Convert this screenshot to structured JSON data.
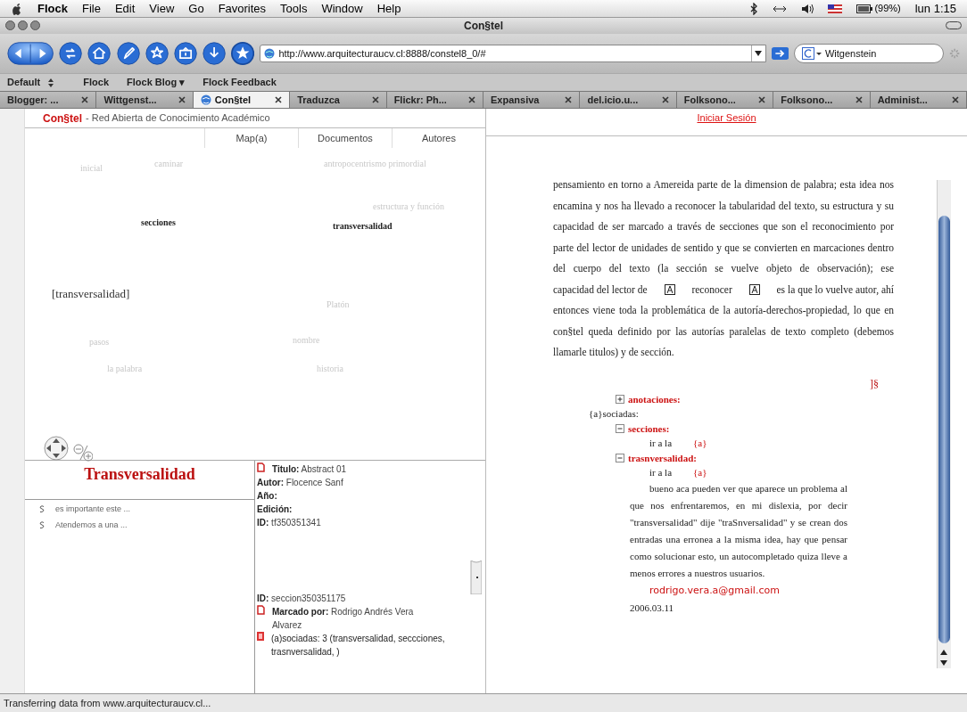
{
  "menu_bar": {
    "app": "Flock",
    "items": [
      "File",
      "Edit",
      "View",
      "Go",
      "Favorites",
      "Tools",
      "Window",
      "Help"
    ],
    "battery": "(99%)",
    "clock": "lun 1:15"
  },
  "window": {
    "title": "Con§tel"
  },
  "toolbar": {
    "url": "http://www.arquitecturaucv.cl:8888/constel8_0/#",
    "search": "Witgenstein"
  },
  "bookmarks": {
    "folder": "Default",
    "items": [
      "Flock",
      "Flock Blog ▾",
      "Flock Feedback"
    ]
  },
  "tabs": [
    {
      "label": "Blogger: ...",
      "selected": false
    },
    {
      "label": "Wittgenst...",
      "selected": false
    },
    {
      "label": "Con§tel",
      "selected": true
    },
    {
      "label": "Traduzca",
      "selected": false
    },
    {
      "label": "Flickr: Ph...",
      "selected": false
    },
    {
      "label": "Expansiva",
      "selected": false
    },
    {
      "label": "del.icio.u...",
      "selected": false
    },
    {
      "label": "Folksono...",
      "selected": false
    },
    {
      "label": "Folksono...",
      "selected": false
    },
    {
      "label": "Administ...",
      "selected": false
    }
  ],
  "site": {
    "logo": "Con§tel",
    "tagline": "- Red Abierta de Conocimiento Académico",
    "nav": [
      "Map(a)",
      "Documentos",
      "Autores"
    ],
    "login": "Iniciar Sesión"
  },
  "word_cloud": [
    {
      "text": "inicial",
      "kind": "faint"
    },
    {
      "text": "caminar",
      "kind": "faint"
    },
    {
      "text": "antropocentrismo primordial",
      "kind": "faint"
    },
    {
      "text": "estructura y función",
      "kind": "faint"
    },
    {
      "text": "secciones",
      "kind": "bold"
    },
    {
      "text": "transversalidad",
      "kind": "bold"
    },
    {
      "text": "[transversalidad]",
      "kind": "current"
    },
    {
      "text": "Platón",
      "kind": "faint"
    },
    {
      "text": "pasos",
      "kind": "faint"
    },
    {
      "text": "nombre",
      "kind": "faint"
    },
    {
      "text": "la palabra",
      "kind": "faint"
    },
    {
      "text": "historia",
      "kind": "faint"
    }
  ],
  "concept": {
    "title": "Transversalidad",
    "sections": [
      "es importante este ...",
      "Atendemos a una ..."
    ]
  },
  "details": {
    "document": [
      {
        "label": "Titulo:",
        "value": "Abstract 01"
      },
      {
        "label": "Autor:",
        "value": "Flocence Sanf"
      },
      {
        "label": "Año:"
      },
      {
        "label": "Edición:"
      },
      {
        "label": "ID:",
        "value": "tf350351341"
      }
    ],
    "section_id": {
      "label": "ID:",
      "value": "seccion350351175"
    },
    "marked_by": {
      "label": "Marcado por:",
      "value": "Rodrigo Andrés Vera Alvarez"
    },
    "associated": "(a)sociadas: 3 (transversalidad, seccciones, trasnversalidad, )"
  },
  "article": {
    "before": "pensamiento en torno a Amereida parte de la dimension de palabra; esta idea nos encamina y nos ha llevado a reconocer la tabularidad del texto, su estructura y su capacidad de ser marcado a través de secciones que son el reconocimiento por parte del lector de unidades de sentido y que se convierten en marcaciones dentro del cuerpo del texto (la sección se vuelve objeto de observación); ese",
    "line": [
      "capacidad del lector de",
      "reconocer",
      "es la que lo vuelve autor, ahí"
    ],
    "after": "entonces viene toda la problemática de la autoría-derechos-propiedad, lo que en con§tel queda definido por las autorías paralelas de texto completo (debemos llamarle titulos) y de sección.",
    "section_marker": "]§"
  },
  "annotations": {
    "root": {
      "label": "anotaciones:",
      "expanded": false
    },
    "associated_label": "{a}sociadas:",
    "groups": [
      {
        "label": "secciones:",
        "expanded": true,
        "link_text": "ir a la",
        "link": "{a}"
      },
      {
        "label": "trasnversalidad:",
        "expanded": true,
        "link_text": "ir a la",
        "link": "{a}"
      }
    ],
    "comment": "bueno aca pueden ver que aparece un problema al que nos enfrentaremos, en mi dislexia, por decir \"transversalidad\" dije \"traSnversalidad\" y se crean dos entradas una erronea a la misma idea, hay que pensar como solucionar esto, un autocompletado quiza lleve a menos errores a nuestros usuarios.",
    "email": "rodrigo.vera.a@gmail.com",
    "date": "2006.03.11"
  },
  "status_bar": "Transferring data from www.arquitecturaucv.cl..."
}
